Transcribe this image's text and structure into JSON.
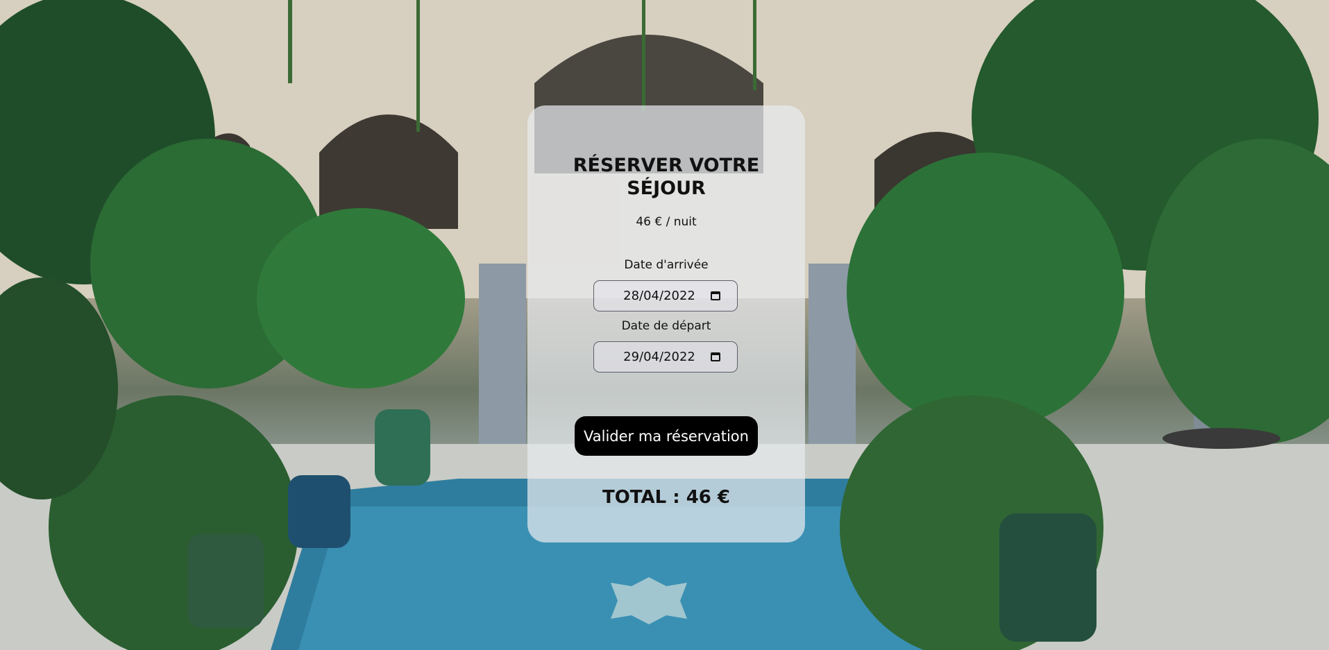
{
  "booking": {
    "title": "RÉSERVER VOTRE SÉJOUR",
    "price_per_night": "46 € / nuit",
    "arrival_label": "Date d'arrivée",
    "arrival_value": "28/04/2022",
    "departure_label": "Date de départ",
    "departure_value": "29/04/2022",
    "submit_label": "Valider ma réservation",
    "total": "TOTAL : 46 €"
  },
  "icons": {
    "date_picker": "calendar-icon"
  },
  "colors": {
    "button_bg": "#000000",
    "button_text": "#ffffff",
    "card_bg": "#e8eaee"
  }
}
